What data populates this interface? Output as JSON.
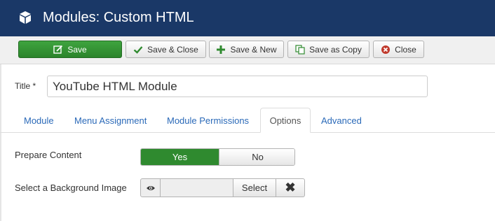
{
  "header": {
    "title": "Modules: Custom HTML",
    "icon": "cube-icon"
  },
  "toolbar": {
    "save_label": "Save",
    "save_close_label": "Save & Close",
    "save_new_label": "Save & New",
    "save_copy_label": "Save as Copy",
    "close_label": "Close"
  },
  "form": {
    "title_label": "Title *",
    "title_value": "YouTube HTML Module"
  },
  "tabs": [
    {
      "label": "Module",
      "active": false
    },
    {
      "label": "Menu Assignment",
      "active": false
    },
    {
      "label": "Module Permissions",
      "active": false
    },
    {
      "label": "Options",
      "active": true
    },
    {
      "label": "Advanced",
      "active": false
    }
  ],
  "options": {
    "prepare_content_label": "Prepare Content",
    "yes_label": "Yes",
    "no_label": "No",
    "selected": "Yes",
    "background_label": "Select a Background Image",
    "select_label": "Select",
    "clear_symbol": "✖"
  },
  "colors": {
    "header_bg": "#1a3867",
    "save_green": "#2f8a2f",
    "link_blue": "#2a69b8"
  }
}
